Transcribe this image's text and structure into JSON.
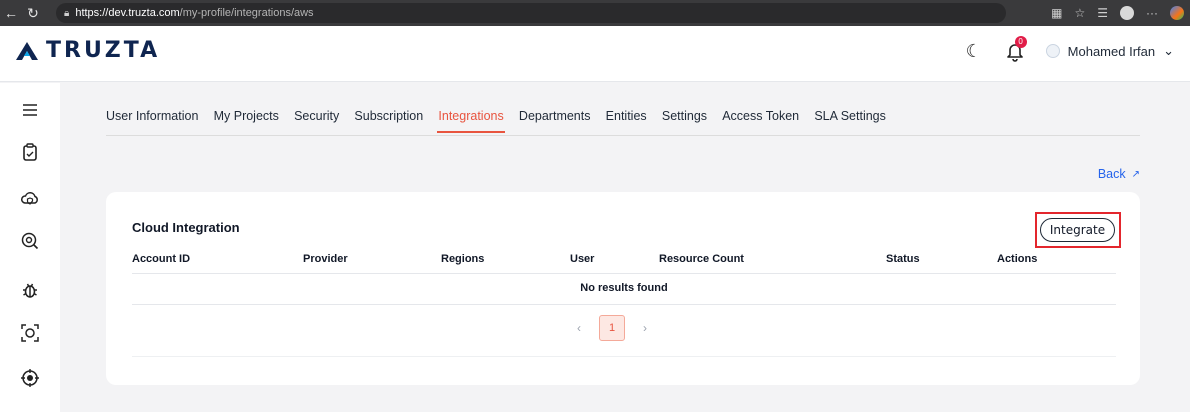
{
  "browser": {
    "url_host": "https://dev.truzta.com",
    "url_path": "/my-profile/integrations/aws"
  },
  "header": {
    "brand": "TRUZTA",
    "notification_count": "0",
    "user_name": "Mohamed Irfan"
  },
  "sidebar": {
    "items": [
      {
        "icon": "menu-icon"
      },
      {
        "icon": "clipboard-check-icon"
      },
      {
        "icon": "cloud-shield-icon"
      },
      {
        "icon": "search-scan-icon"
      },
      {
        "icon": "bug-icon"
      },
      {
        "icon": "scan-frame-icon"
      },
      {
        "icon": "crosshair-icon"
      }
    ]
  },
  "tabs": [
    {
      "label": "User Information",
      "active": false
    },
    {
      "label": "My Projects",
      "active": false
    },
    {
      "label": "Security",
      "active": false
    },
    {
      "label": "Subscription",
      "active": false
    },
    {
      "label": "Integrations",
      "active": true
    },
    {
      "label": "Departments",
      "active": false
    },
    {
      "label": "Entities",
      "active": false
    },
    {
      "label": "Settings",
      "active": false
    },
    {
      "label": "Access Token",
      "active": false
    },
    {
      "label": "SLA Settings",
      "active": false
    }
  ],
  "back_label": "Back",
  "card": {
    "title": "Cloud Integration",
    "integrate_label": "Integrate",
    "columns": [
      "Account ID",
      "Provider",
      "Regions",
      "User",
      "Resource Count",
      "Status",
      "Actions"
    ],
    "empty_message": "No results found",
    "pagination": {
      "current_page": "1",
      "prev": "‹",
      "next": "›"
    }
  },
  "colors": {
    "accent": "#e8543f",
    "link": "#2563eb",
    "highlight": "#e3262d",
    "brand_navy": "#0f2550"
  }
}
